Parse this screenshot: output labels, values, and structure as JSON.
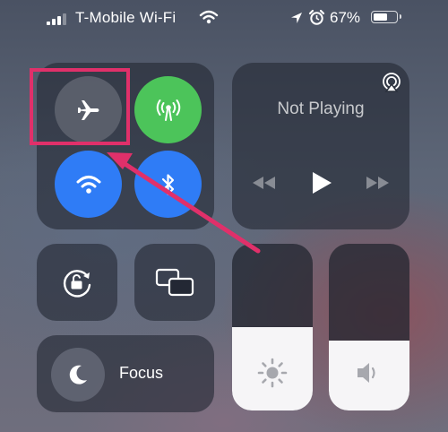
{
  "status_bar": {
    "carrier": "T-Mobile Wi-Fi",
    "battery_percent": "67%",
    "battery_level": 0.67,
    "signal_bars_filled": 3,
    "icons": [
      "signal-icon",
      "wifi-icon",
      "location-arrow-icon",
      "alarm-clock-icon",
      "battery-icon"
    ]
  },
  "connectivity": {
    "airplane_mode": {
      "icon": "airplane-icon",
      "active": false
    },
    "cellular_data": {
      "icon": "cellular-antenna-icon",
      "active": true,
      "color": "#4cc45a"
    },
    "wifi": {
      "icon": "wifi-icon",
      "active": true,
      "color": "#2f7cf6"
    },
    "bluetooth": {
      "icon": "bluetooth-icon",
      "active": true,
      "color": "#2f7cf6"
    }
  },
  "now_playing": {
    "title": "Not Playing",
    "icons": [
      "airplay-icon",
      "rewind-icon",
      "play-icon",
      "fast-forward-icon"
    ]
  },
  "controls": {
    "orientation_lock": {
      "icon": "rotation-lock-icon"
    },
    "screen_mirroring": {
      "icon": "screen-mirroring-icon"
    },
    "focus": {
      "label": "Focus",
      "icon": "moon-icon"
    }
  },
  "sliders": {
    "brightness": {
      "icon": "sun-icon",
      "level": 0.5
    },
    "volume": {
      "icon": "speaker-icon",
      "level": 0.42
    }
  },
  "annotation": {
    "highlight_color": "#e0306a",
    "target": "airplane-mode-button"
  }
}
